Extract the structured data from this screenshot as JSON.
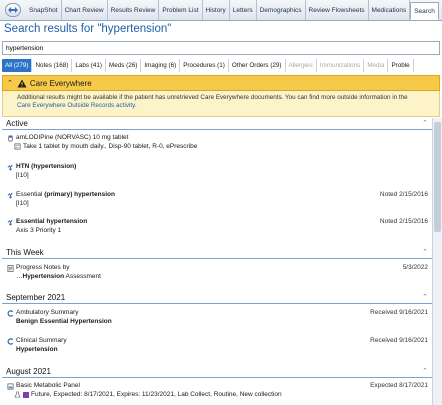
{
  "tabs": [
    "SnapShot",
    "Chart Review",
    "Results Review",
    "Problem List",
    "History",
    "Letters",
    "Demographics",
    "Review Flowsheets",
    "Medications",
    "Search"
  ],
  "title": "Search results for \"hypertension\"",
  "search_value": "hypertension",
  "filters": [
    {
      "label": "All (279)",
      "state": "active"
    },
    {
      "label": "Notes (168)",
      "state": "normal"
    },
    {
      "label": "Labs (41)",
      "state": "normal"
    },
    {
      "label": "Meds (26)",
      "state": "normal"
    },
    {
      "label": "Imaging (6)",
      "state": "normal"
    },
    {
      "label": "Procedures (1)",
      "state": "normal"
    },
    {
      "label": "Other Orders (29)",
      "state": "normal"
    },
    {
      "label": "Allergies",
      "state": "disabled"
    },
    {
      "label": "Immunizations",
      "state": "disabled"
    },
    {
      "label": "Media",
      "state": "disabled"
    },
    {
      "label": "Proble",
      "state": "normal"
    }
  ],
  "care_everywhere": {
    "title": "Care Everywhere",
    "info_text": "Additional results might be available if the patient has unretrieved Care Everywhere documents. You can find more outside information in the",
    "link_text": "Care Everywhere Outside Records activity."
  },
  "sections": {
    "active": "Active",
    "this_week": "This Week",
    "sep_2021": "September 2021",
    "aug_2021": "August 2021"
  },
  "results": {
    "amlodipine": {
      "title": "amLODIPine (NORVASC) 10 mg tablet",
      "detail": "Take 1 tablet by mouth daily., Disp-90 tablet, R-0, ePrescribe"
    },
    "htn": {
      "title_bold": "HTN (hypertension)",
      "code": "[I10]"
    },
    "essential_primary": {
      "title_pre": "Essential ",
      "title_bold": "(primary) hypertension",
      "code": "[I10]",
      "date": "Noted 2/15/2016"
    },
    "essential": {
      "title_bold": "Essential hypertension",
      "detail": "Axis 3 Priority 1",
      "date": "Noted 2/15/2016"
    },
    "progress_notes": {
      "title": "Progress Notes by",
      "detail_bold": "Hypertension",
      "detail_rest": " Assessment",
      "date": "5/3/2022"
    },
    "ambulatory": {
      "title": "Ambulatory Summary",
      "detail": "Benign Essential Hypertension",
      "date": "Received 9/16/2021"
    },
    "clinical": {
      "title": "Clinical Summary",
      "detail": "Hypertension",
      "date": "Received 9/16/2021"
    },
    "bmp": {
      "title": "Basic Metabolic Panel",
      "detail": "Future, Expected: 8/17/2021, Expires: 11/23/2021, Lab Collect, Routine, New collection",
      "date": "Expected 8/17/2021"
    }
  },
  "colors": {
    "accent": "#1f5fa8",
    "filter_active": "#2a73c7",
    "banner": "#f7c948"
  }
}
